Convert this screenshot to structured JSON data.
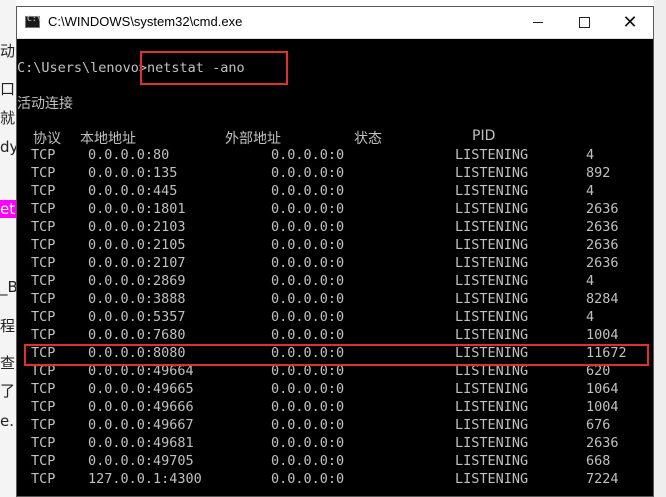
{
  "window": {
    "title": "C:\\WINDOWS\\system32\\cmd.exe",
    "controls": {
      "minimize": "minimize",
      "maximize": "maximize",
      "close": "close"
    }
  },
  "background_fragments": [
    "动的",
    "口,",
    "就",
    "dy",
    "ets",
    "_B",
    "程",
    "查",
    "了",
    "e. J"
  ],
  "console": {
    "command_line": "C:\\Users\\lenovo>netstat -ano",
    "heading": "活动连接",
    "columns": [
      "协议",
      "本地地址",
      "外部地址",
      "状态",
      "PID"
    ],
    "rows": [
      {
        "proto": "TCP",
        "local": "0.0.0.0:80",
        "foreign": "0.0.0.0:0",
        "state": "LISTENING",
        "pid": "4"
      },
      {
        "proto": "TCP",
        "local": "0.0.0.0:135",
        "foreign": "0.0.0.0:0",
        "state": "LISTENING",
        "pid": "892"
      },
      {
        "proto": "TCP",
        "local": "0.0.0.0:445",
        "foreign": "0.0.0.0:0",
        "state": "LISTENING",
        "pid": "4"
      },
      {
        "proto": "TCP",
        "local": "0.0.0.0:1801",
        "foreign": "0.0.0.0:0",
        "state": "LISTENING",
        "pid": "2636"
      },
      {
        "proto": "TCP",
        "local": "0.0.0.0:2103",
        "foreign": "0.0.0.0:0",
        "state": "LISTENING",
        "pid": "2636"
      },
      {
        "proto": "TCP",
        "local": "0.0.0.0:2105",
        "foreign": "0.0.0.0:0",
        "state": "LISTENING",
        "pid": "2636"
      },
      {
        "proto": "TCP",
        "local": "0.0.0.0:2107",
        "foreign": "0.0.0.0:0",
        "state": "LISTENING",
        "pid": "2636"
      },
      {
        "proto": "TCP",
        "local": "0.0.0.0:2869",
        "foreign": "0.0.0.0:0",
        "state": "LISTENING",
        "pid": "4"
      },
      {
        "proto": "TCP",
        "local": "0.0.0.0:3888",
        "foreign": "0.0.0.0:0",
        "state": "LISTENING",
        "pid": "8284"
      },
      {
        "proto": "TCP",
        "local": "0.0.0.0:5357",
        "foreign": "0.0.0.0:0",
        "state": "LISTENING",
        "pid": "4"
      },
      {
        "proto": "TCP",
        "local": "0.0.0.0:7680",
        "foreign": "0.0.0.0:0",
        "state": "LISTENING",
        "pid": "1004"
      },
      {
        "proto": "TCP",
        "local": "0.0.0.0:8080",
        "foreign": "0.0.0.0:0",
        "state": "LISTENING",
        "pid": "11672"
      },
      {
        "proto": "TCP",
        "local": "0.0.0.0:49664",
        "foreign": "0.0.0.0:0",
        "state": "LISTENING",
        "pid": "620"
      },
      {
        "proto": "TCP",
        "local": "0.0.0.0:49665",
        "foreign": "0.0.0.0:0",
        "state": "LISTENING",
        "pid": "1064"
      },
      {
        "proto": "TCP",
        "local": "0.0.0.0:49666",
        "foreign": "0.0.0.0:0",
        "state": "LISTENING",
        "pid": "1004"
      },
      {
        "proto": "TCP",
        "local": "0.0.0.0:49667",
        "foreign": "0.0.0.0:0",
        "state": "LISTENING",
        "pid": "676"
      },
      {
        "proto": "TCP",
        "local": "0.0.0.0:49681",
        "foreign": "0.0.0.0:0",
        "state": "LISTENING",
        "pid": "2636"
      },
      {
        "proto": "TCP",
        "local": "0.0.0.0:49705",
        "foreign": "0.0.0.0:0",
        "state": "LISTENING",
        "pid": "668"
      },
      {
        "proto": "TCP",
        "local": "127.0.0.1:4300",
        "foreign": "0.0.0.0:0",
        "state": "LISTENING",
        "pid": "7224"
      }
    ]
  },
  "colors": {
    "console_background": "#000000",
    "console_text": "#c0c0c0",
    "highlight": "#e0302f",
    "fragment_highlight": "#ff00ff"
  }
}
